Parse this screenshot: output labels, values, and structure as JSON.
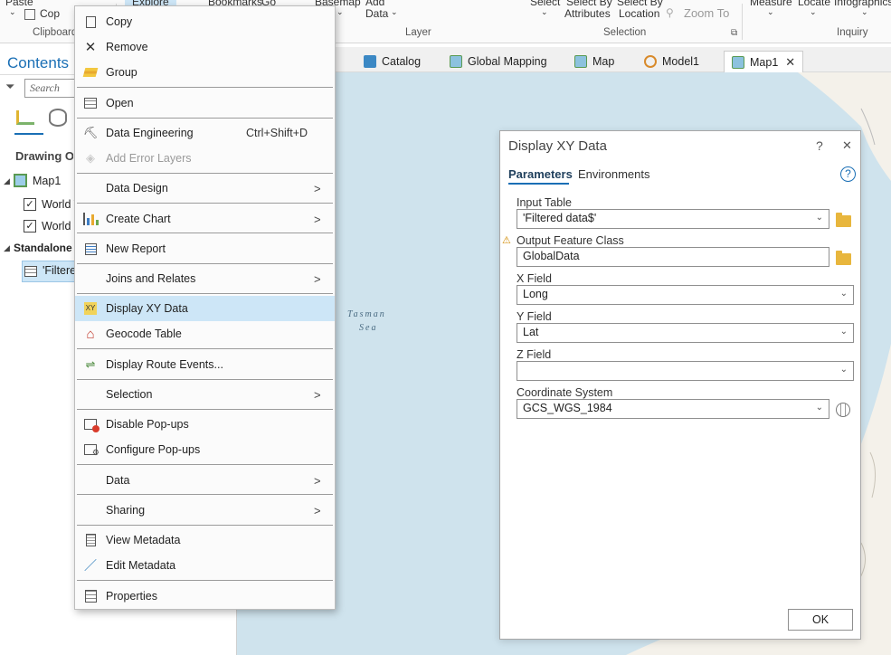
{
  "ribbon": {
    "top_texts": [
      "Paste",
      "Explore",
      "Bookmarks",
      "Go",
      "Basemap",
      "Add",
      "Select",
      "Select By",
      "Select By",
      "Measure",
      "Locate",
      "Infographics"
    ],
    "copy_partial": "Cop",
    "data_label": "Data",
    "attributes_label": "Attributes",
    "location_label": "Location",
    "zoom_to_label": "Zoom To",
    "groups": {
      "clipboard": "Clipboard",
      "layer": "Layer",
      "selection": "Selection",
      "inquiry": "Inquiry"
    }
  },
  "tabs": [
    {
      "label": "Catalog"
    },
    {
      "label": "Global Mapping"
    },
    {
      "label": "Map"
    },
    {
      "label": "Model1"
    },
    {
      "label": "Map1",
      "close": "✕"
    }
  ],
  "contents": {
    "title": "Contents",
    "search_placeholder": "Search",
    "drawing_order": "Drawing Order",
    "map_label": "Map1",
    "layers": [
      "World Topographic Map",
      "World Hillshade"
    ],
    "standalone_header": "Standalone Tables",
    "table_item": "'Filtered data$'"
  },
  "context_menu": {
    "items": [
      {
        "label": "Copy",
        "icon": "copy-icon"
      },
      {
        "label": "Remove",
        "icon": "remove-icon"
      },
      {
        "label": "Group",
        "icon": "group-icon"
      },
      {
        "label": "Open",
        "icon": "table-icon"
      },
      {
        "label": "Data Engineering",
        "icon": "data-engineering-icon",
        "shortcut": "Ctrl+Shift+D"
      },
      {
        "label": "Add Error Layers",
        "icon": "error-layers-icon",
        "disabled": true
      },
      {
        "label": "Data Design",
        "submenu": true
      },
      {
        "label": "Create Chart",
        "icon": "chart-icon",
        "submenu": true
      },
      {
        "label": "New Report",
        "icon": "report-icon"
      },
      {
        "label": "Joins and Relates",
        "submenu": true
      },
      {
        "label": "Display XY Data",
        "icon": "xy-data-icon",
        "highlighted": true
      },
      {
        "label": "Geocode Table",
        "icon": "geocode-icon"
      },
      {
        "label": "Display Route Events...",
        "icon": "route-events-icon"
      },
      {
        "label": "Selection",
        "submenu": true
      },
      {
        "label": "Disable Pop-ups",
        "icon": "disable-popups-icon"
      },
      {
        "label": "Configure Pop-ups",
        "icon": "configure-popups-icon"
      },
      {
        "label": "Data",
        "submenu": true
      },
      {
        "label": "Sharing",
        "submenu": true
      },
      {
        "label": "View Metadata",
        "icon": "view-metadata-icon"
      },
      {
        "label": "Edit Metadata",
        "icon": "edit-metadata-icon"
      },
      {
        "label": "Properties",
        "icon": "properties-icon"
      }
    ],
    "arrow": ">"
  },
  "map": {
    "label_line1": "Tasman",
    "label_line2": "Sea"
  },
  "dialog": {
    "title": "Display XY Data",
    "help": "?",
    "close": "✕",
    "tab_parameters": "Parameters",
    "tab_environments": "Environments",
    "help_icon_text": "?",
    "input_table_label": "Input Table",
    "input_table_value": "'Filtered data$'",
    "output_label": "Output Feature Class",
    "output_value": "GlobalData",
    "x_label": "X Field",
    "x_value": "Long",
    "y_label": "Y Field",
    "y_value": "Lat",
    "z_label": "Z Field",
    "z_value": "",
    "cs_label": "Coordinate System",
    "cs_value": "GCS_WGS_1984",
    "ok": "OK"
  },
  "colors": {
    "accent": "#1a6fb5",
    "highlight": "#cde6f7",
    "map_water": "#cfe3ed",
    "folder": "#e8b63d"
  }
}
